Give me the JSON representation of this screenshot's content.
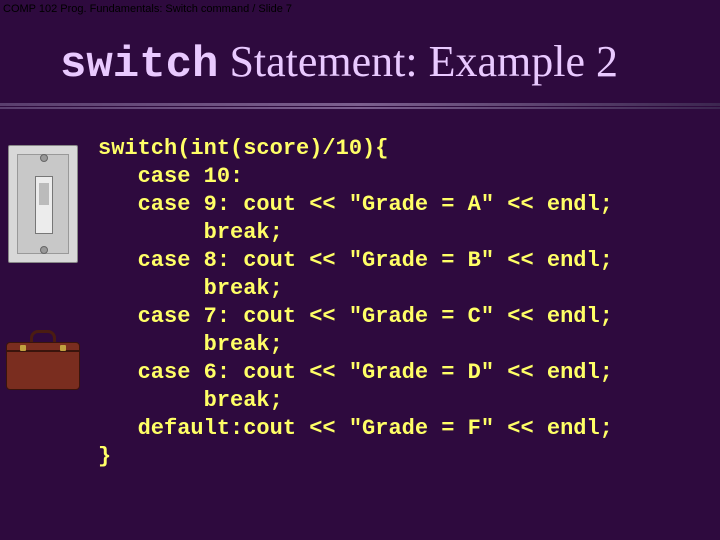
{
  "breadcrumb": "COMP 102 Prog. Fundamentals: Switch command / Slide 7",
  "title_mono": "switch",
  "title_rest": " Statement: Example 2",
  "code": "switch(int(score)/10){\n   case 10:\n   case 9: cout << \"Grade = A\" << endl;\n        break;\n   case 8: cout << \"Grade = B\" << endl;\n        break;\n   case 7: cout << \"Grade = C\" << endl;\n        break;\n   case 6: cout << \"Grade = D\" << endl;\n        break;\n   default:cout << \"Grade = F\" << endl;\n}"
}
